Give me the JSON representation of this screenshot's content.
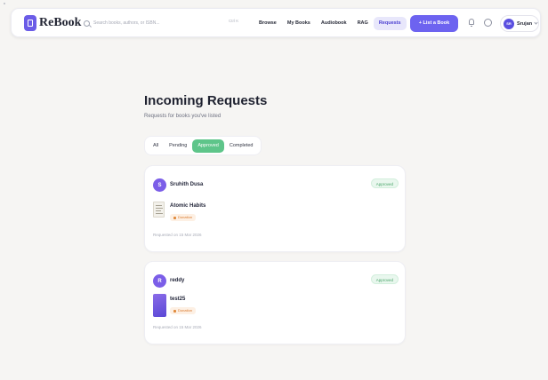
{
  "app": {
    "name": "ReBook"
  },
  "search": {
    "placeholder": "Search books, authors, or ISBN...",
    "shortcut": "Ctrl K"
  },
  "nav": {
    "links": [
      "Browse",
      "My Books",
      "Audiobook",
      "RAG",
      "Requests"
    ],
    "active": "Requests",
    "list_book_label": "+ List a Book"
  },
  "user": {
    "initials": "SR",
    "name": "Srujan"
  },
  "page": {
    "title": "Incoming Requests",
    "subtitle": "Requests for books you've listed"
  },
  "tabs": [
    "All",
    "Pending",
    "Approved",
    "Completed"
  ],
  "active_tab": "Approved",
  "requests": [
    {
      "avatar_initial": "S",
      "requester": "Sruhith Dusa",
      "status": "Approved",
      "book_title": "Atomic Habits",
      "type": "Donation",
      "date": "Requested on 15 Mar 2026"
    },
    {
      "avatar_initial": "R",
      "requester": "reddy",
      "status": "Approved",
      "book_title": "test25",
      "type": "Donation",
      "date": "Requested on 15 Mar 2026"
    }
  ],
  "colors": {
    "brand": "#6b5ce7",
    "primary_button": "#6d63f0",
    "active_tab": "#5ec58a",
    "approved_badge_text": "#4aa46a",
    "donation_tag_text": "#d9782b",
    "background": "#f6f5f3"
  },
  "icons": {
    "logo": "book-icon",
    "search": "search-icon",
    "notifications": "bell-icon",
    "messages": "chat-icon",
    "user_menu": "chevron-down-icon",
    "donation": "gift-icon"
  }
}
